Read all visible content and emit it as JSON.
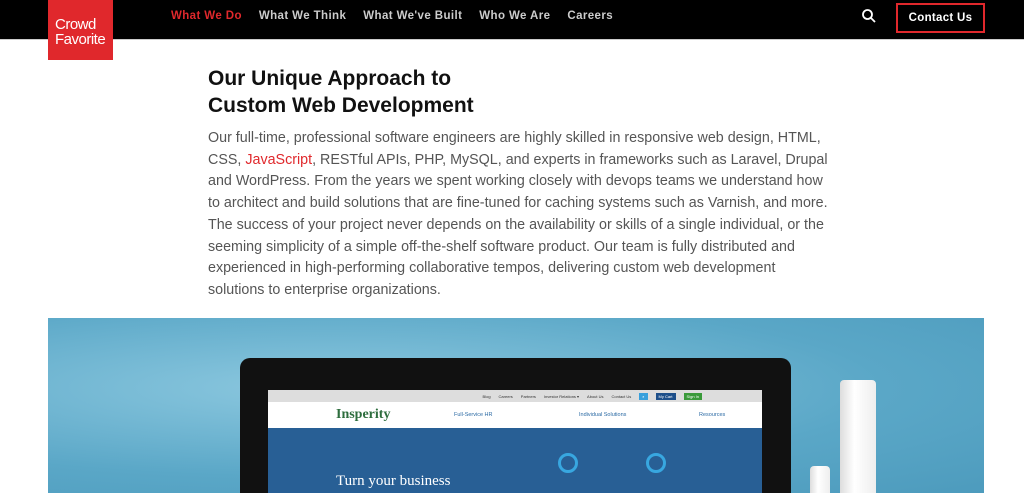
{
  "header": {
    "logo": [
      "Crowd",
      "Favorite"
    ],
    "nav": [
      {
        "label": "What We Do",
        "active": true
      },
      {
        "label": "What We Think"
      },
      {
        "label": "What We've Built"
      },
      {
        "label": "Who We Are"
      },
      {
        "label": "Careers"
      }
    ],
    "search_icon": "search-icon",
    "contact_label": "Contact Us",
    "accent": "#e0282c"
  },
  "main": {
    "title_line1": "Our Unique Approach to",
    "title_line2": "Custom Web Development",
    "para_before": "Our full-time, professional software engineers are highly skilled in responsive web design, HTML, CSS, ",
    "para_link": "JavaScript",
    "para_after": ", RESTful APIs, PHP, MySQL, and experts in frameworks such as Laravel, Drupal and WordPress. From the years we spent working closely with devops teams we understand how to architect and build solutions that are fine-tuned for caching systems such as Varnish, and more. The success of your project never depends on the availability or skills of a single individual, or the seeming simplicity of a simple off-the-shelf software product. Our team is fully distributed and experienced in high-performing collaborative tempos, delivering custom web development solutions to enterprise organizations."
  },
  "hero": {
    "topbar": [
      "Blog",
      "Careers",
      "Partners",
      "Investor Relations ▾",
      "About Us",
      "Contact Us"
    ],
    "cart": "My Cart",
    "signin": "Sign In",
    "logo": "Insperity",
    "nav": [
      "Full-Service HR",
      "Individual Solutions",
      "Resources"
    ],
    "headline": "Turn your business"
  }
}
